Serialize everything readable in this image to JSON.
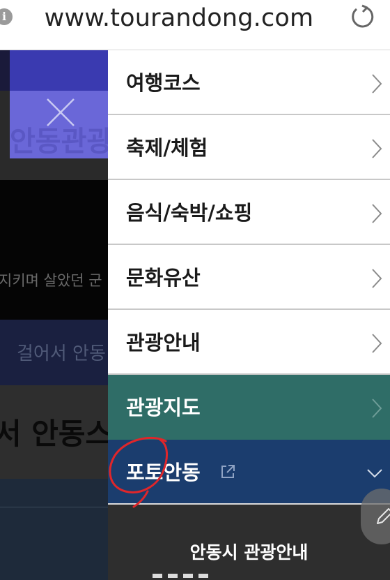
{
  "browser": {
    "url": "www.tourandong.com",
    "info_icon": "info-icon",
    "reload_icon": "reload-icon"
  },
  "background_page": {
    "title_partial": "안동관광",
    "hero_text_partial": "지키며 살았던 군",
    "band_text_partial": "걸어서 안동",
    "section_heading_partial": "서 안동스"
  },
  "menu": {
    "items": [
      {
        "label": "여행코스",
        "icon": "chevron-right-icon"
      },
      {
        "label": "축제/체험",
        "icon": "chevron-right-icon"
      },
      {
        "label": "음식/숙박/쇼핑",
        "icon": "chevron-right-icon"
      },
      {
        "label": "문화유산",
        "icon": "chevron-right-icon"
      },
      {
        "label": "관광안내",
        "icon": "chevron-right-icon"
      }
    ],
    "map_item": {
      "label": "관광지도",
      "icon": "chevron-right-icon",
      "color": "#2f6d67"
    },
    "photo_item": {
      "label": "포토안동",
      "icon": "external-link-icon",
      "expand_icon": "chevron-down-icon",
      "color": "#1b3d6e"
    },
    "footer_title": "안동시 관광안내"
  },
  "colors": {
    "teal": "#2f6d67",
    "navy": "#1b3d6e",
    "annotation_red": "#e0262a"
  }
}
